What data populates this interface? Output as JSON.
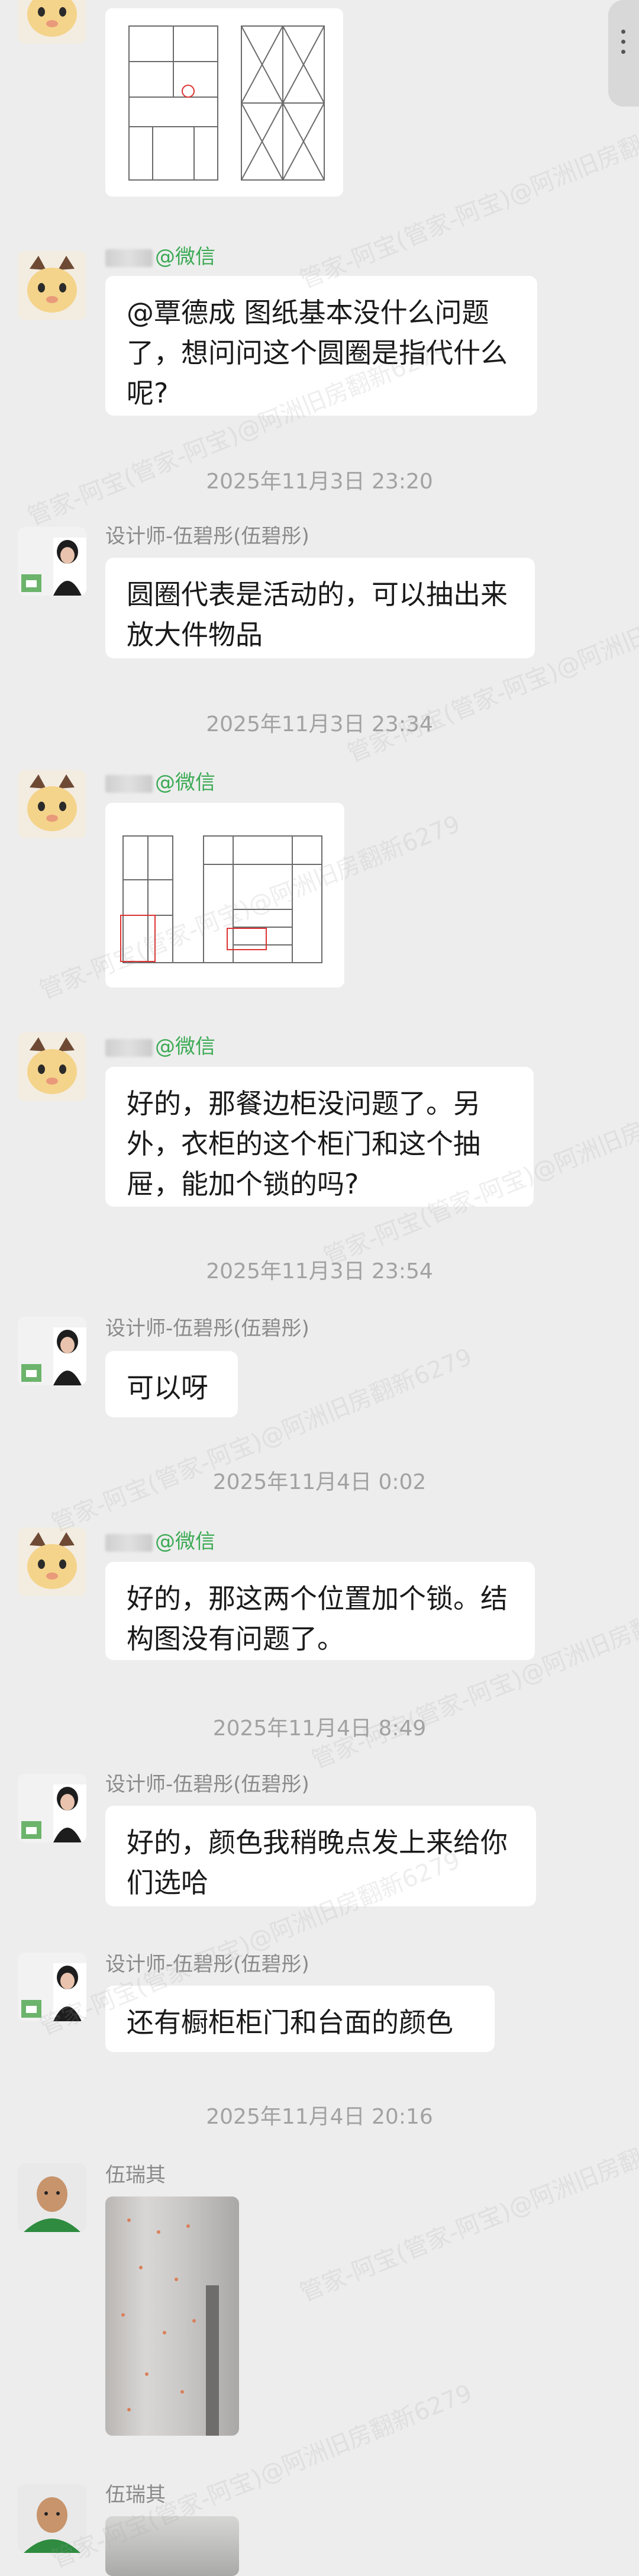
{
  "watermark_text": "管家-阿宝(管家-阿宝)@阿洲旧房翻新6279",
  "messages": {
    "m1": {
      "sender": "@微信",
      "text": "@覃德成 图纸基本没什么问题了，想问问这个圆圈是指代什么呢?"
    },
    "t1": "2025年11月3日  23:20",
    "m2": {
      "sender": "设计师-伍碧彤(伍碧彤)",
      "text": "圆圈代表是活动的，可以抽出来放大件物品"
    },
    "t2": "2025年11月3日  23:34",
    "m3": {
      "sender": "@微信"
    },
    "m4": {
      "sender": "@微信",
      "text": "好的，那餐边柜没问题了。另外，衣柜的这个柜门和这个抽屉，能加个锁的吗?"
    },
    "t3": "2025年11月3日  23:54",
    "m5": {
      "sender": "设计师-伍碧彤(伍碧彤)",
      "text": "可以呀"
    },
    "t4": "2025年11月4日  0:02",
    "m6": {
      "sender": "@微信",
      "text": "好的，那这两个位置加个锁。结构图没有问题了。"
    },
    "t5": "2025年11月4日  8:49",
    "m7": {
      "sender": "设计师-伍碧彤(伍碧彤)",
      "text": "好的，颜色我稍晚点发上来给你们选哈"
    },
    "m8": {
      "sender": "设计师-伍碧彤(伍碧彤)",
      "text": "还有橱柜柜门和台面的颜色"
    },
    "t6": "2025年11月4日  20:16",
    "m9": {
      "sender": "伍瑞其"
    },
    "m10": {
      "sender": "伍瑞其"
    }
  },
  "icons": {
    "cat_avatar": "cat-avatar",
    "designer_avatar": "designer-avatar",
    "man_avatar": "man-avatar"
  },
  "colors": {
    "background": "#ededed",
    "bubble": "#ffffff",
    "wechat_green": "#3caa55",
    "timestamp": "#a2a2a2"
  }
}
